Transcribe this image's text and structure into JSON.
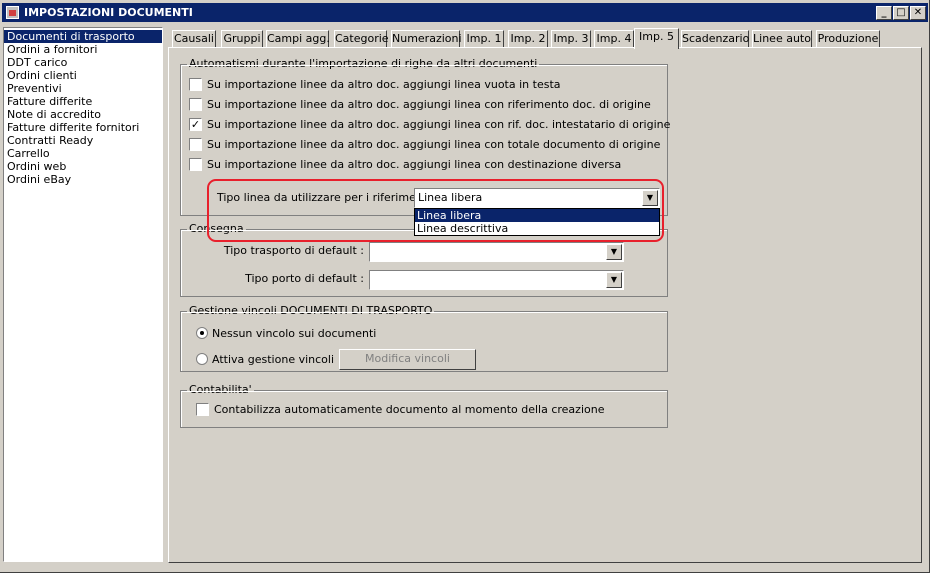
{
  "window": {
    "title": "IMPOSTAZIONI DOCUMENTI",
    "controls": [
      "minimize-icon",
      "maximize-icon",
      "close-icon"
    ]
  },
  "sidebar": {
    "items": [
      {
        "label": "Documenti di trasporto",
        "selected": true
      },
      {
        "label": "Ordini a fornitori"
      },
      {
        "label": "DDT carico"
      },
      {
        "label": "Ordini clienti"
      },
      {
        "label": "Preventivi"
      },
      {
        "label": "Fatture differite"
      },
      {
        "label": "Note di accredito"
      },
      {
        "label": "Fatture differite fornitori"
      },
      {
        "label": "Contratti Ready"
      },
      {
        "label": "Carrello"
      },
      {
        "label": "Ordini web"
      },
      {
        "label": "Ordini eBay"
      }
    ]
  },
  "tabs": [
    {
      "label": "Causali"
    },
    {
      "label": "Gruppi"
    },
    {
      "label": "Campi agg."
    },
    {
      "label": "Categorie"
    },
    {
      "label": "Numerazioni"
    },
    {
      "label": "Imp. 1"
    },
    {
      "label": "Imp. 2"
    },
    {
      "label": "Imp. 3"
    },
    {
      "label": "Imp. 4"
    },
    {
      "label": "Imp. 5",
      "active": true
    },
    {
      "label": "Scadenzario"
    },
    {
      "label": "Linee auto"
    },
    {
      "label": "Produzione"
    }
  ],
  "automatismi": {
    "title": "Automatismi durante l'importazione di righe da altri documenti",
    "options": [
      {
        "label": "Su importazione linee da altro doc. aggiungi linea vuota in testa",
        "checked": false
      },
      {
        "label": "Su importazione linee da altro doc. aggiungi linea con riferimento doc. di origine",
        "checked": false
      },
      {
        "label": "Su importazione linee da altro doc. aggiungi linea con rif. doc. intestatario di origine",
        "checked": true
      },
      {
        "label": "Su importazione linee da altro doc. aggiungi linea con totale documento di origine",
        "checked": false
      },
      {
        "label": "Su importazione linee da altro doc. aggiungi linea con destinazione diversa",
        "checked": false
      }
    ],
    "tipo_linea_label": "Tipo linea da utilizzare per i riferimenti :",
    "tipo_linea_value": "Linea libera",
    "tipo_linea_options": [
      "Linea libera",
      "Linea descrittiva"
    ]
  },
  "consegna": {
    "title": "Consegna",
    "trasporto_label": "Tipo trasporto di default :",
    "trasporto_value": "",
    "porto_label": "Tipo porto di default :",
    "porto_value": ""
  },
  "vincoli": {
    "title": "Gestione vincoli DOCUMENTI DI TRASPORTO",
    "nessun_label": "Nessun vincolo sui documenti",
    "attiva_label": "Attiva gestione vincoli",
    "modifica_button": "Modifica vincoli",
    "selected": "nessun"
  },
  "contabilita": {
    "title": "Contabilita'",
    "option_label": "Contabilizza automaticamente documento al momento della creazione",
    "checked": false
  },
  "colors": {
    "title_bar": "#0a246a",
    "selection": "#0a246a",
    "highlight_annotation": "#e8202c",
    "face": "#d4d0c8"
  }
}
